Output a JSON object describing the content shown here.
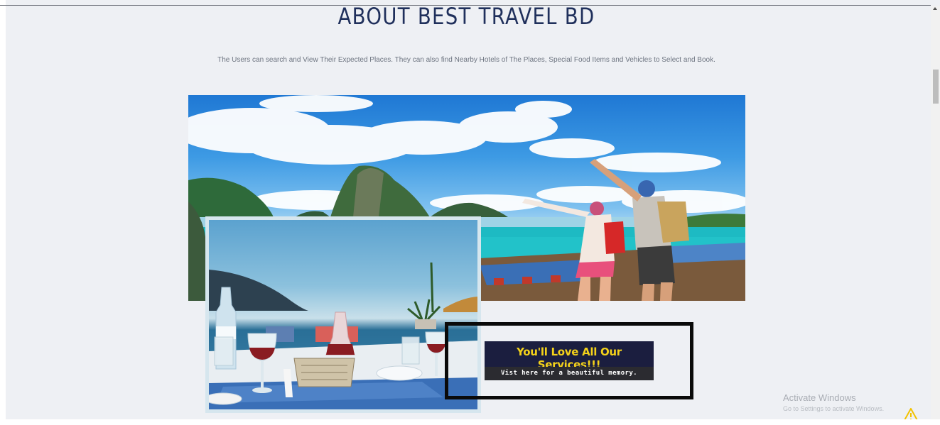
{
  "about": {
    "title": "ABOUT BEST TRAVEL BD",
    "intro": "The Users can search and View Their Expected Places. They can also find Nearby Hotels of The Places, Special Food Items and Vehicles to Select and Book."
  },
  "ad": {
    "headline": "You'll Love All Our Services!!!",
    "subline": "Vist here for a beautiful memory."
  },
  "watermark": {
    "title": "Activate Windows",
    "subtitle": "Go to Settings to activate Windows."
  },
  "colors": {
    "page_bg": "#eef0f4",
    "title": "#20305c",
    "ad_bg": "#1b1e3f",
    "ad_headline": "#f4d21a",
    "ad_frame": "#0a0a0a",
    "warning": "#f2c200"
  },
  "icons": {
    "scroll_up": "scroll-up-arrow-icon",
    "warning": "warning-icon"
  }
}
